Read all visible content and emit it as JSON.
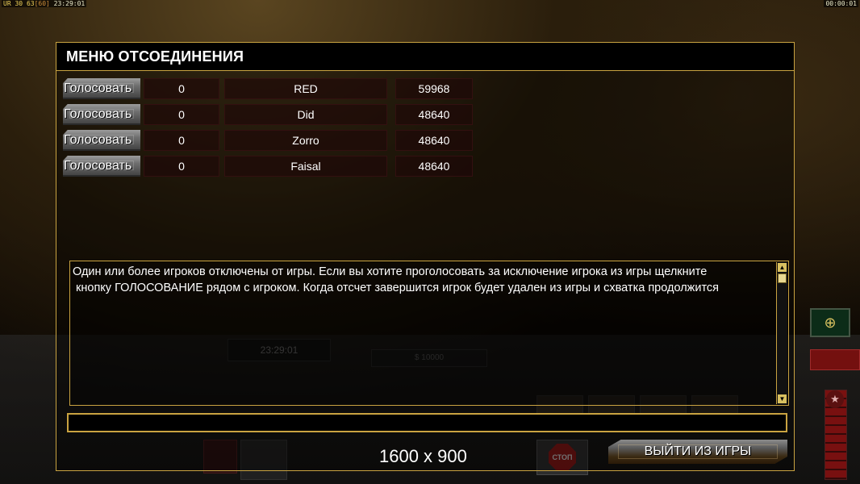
{
  "topbar": {
    "game_code": "UR",
    "fps_current": "30",
    "fps_a": "63",
    "fps_b": "[60]",
    "clock": "23:29:01",
    "timer": "00:00:01"
  },
  "hud": {
    "clock": "23:29:01",
    "money": "$ 10000",
    "stop_label": "СТОП"
  },
  "dialog": {
    "title": "МЕНЮ ОТСОЕДИНЕНИЯ",
    "players": [
      {
        "vote_label": "Голосовать",
        "count": "0",
        "name": "RED",
        "ping": "59968"
      },
      {
        "vote_label": "Голосовать",
        "count": "0",
        "name": "Did",
        "ping": "48640"
      },
      {
        "vote_label": "Голосовать",
        "count": "0",
        "name": "Zorro",
        "ping": "48640"
      },
      {
        "vote_label": "Голосовать",
        "count": "0",
        "name": "Faisal",
        "ping": "48640"
      }
    ],
    "message": "Один или более игроков отключены от игры. Если вы хотите проголосовать за исключение игрока из игры щелкните\n кнопку ГОЛОСОВАНИЕ рядом с игроком. Когда отсчет завершится игрок будет удален из игры и схватка продолжится",
    "chat_input": "",
    "resolution": "1600 x 900",
    "exit_label": "ВЫЙТИ ИЗ ИГРЫ"
  }
}
